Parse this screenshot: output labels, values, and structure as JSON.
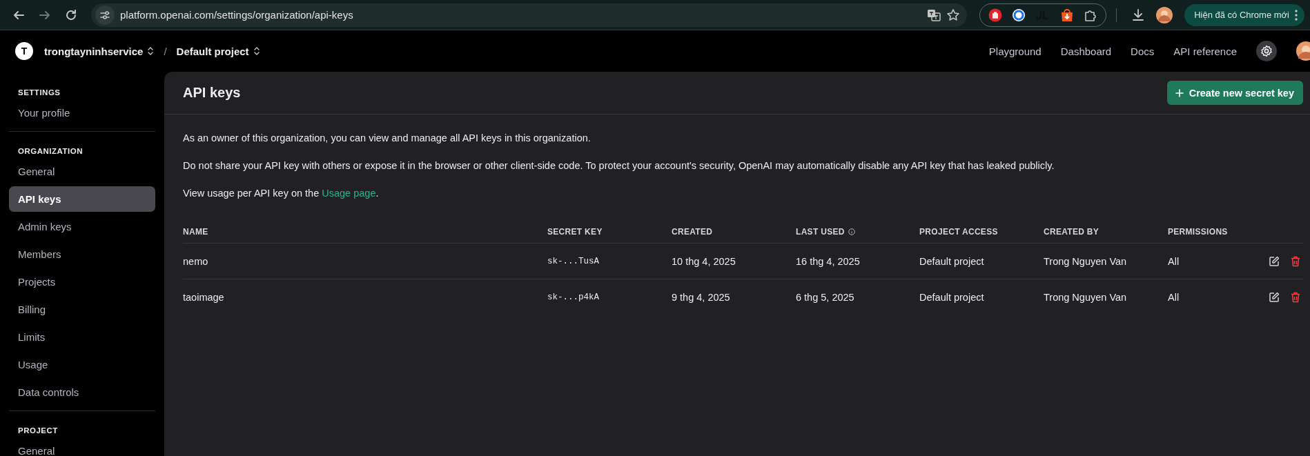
{
  "browser": {
    "url": "platform.openai.com/settings/organization/api-keys",
    "update_button": "Hiện đã có Chrome mới"
  },
  "header": {
    "org_initial": "T",
    "org_name": "trongtayninhservice",
    "separator": "/",
    "project_name": "Default project",
    "nav": [
      "Playground",
      "Dashboard",
      "Docs",
      "API reference"
    ]
  },
  "sidebar": {
    "sections": [
      {
        "heading": "SETTINGS",
        "items": [
          {
            "label": "Your profile",
            "selected": false
          }
        ]
      },
      {
        "heading": "ORGANIZATION",
        "items": [
          {
            "label": "General",
            "selected": false
          },
          {
            "label": "API keys",
            "selected": true
          },
          {
            "label": "Admin keys",
            "selected": false
          },
          {
            "label": "Members",
            "selected": false
          },
          {
            "label": "Projects",
            "selected": false
          },
          {
            "label": "Billing",
            "selected": false
          },
          {
            "label": "Limits",
            "selected": false
          },
          {
            "label": "Usage",
            "selected": false
          },
          {
            "label": "Data controls",
            "selected": false
          }
        ]
      },
      {
        "heading": "PROJECT",
        "items": [
          {
            "label": "General",
            "selected": false
          }
        ]
      }
    ]
  },
  "panel": {
    "title": "API keys",
    "create_button": "Create new secret key",
    "intro": "As an owner of this organization, you can view and manage all API keys in this organization.",
    "warning": "Do not share your API key with others or expose it in the browser or other client-side code. To protect your account's security, OpenAI may automatically disable any API key that has leaked publicly.",
    "usage_note": {
      "before": "View usage per API key on the ",
      "link": "Usage page",
      "after": "."
    },
    "table": {
      "columns": [
        {
          "label": "NAME",
          "info": false
        },
        {
          "label": "SECRET KEY",
          "info": false
        },
        {
          "label": "CREATED",
          "info": false
        },
        {
          "label": "LAST USED",
          "info": true
        },
        {
          "label": "PROJECT ACCESS",
          "info": false
        },
        {
          "label": "CREATED BY",
          "info": false
        },
        {
          "label": "PERMISSIONS",
          "info": false
        }
      ],
      "rows": [
        {
          "name": "nemo",
          "secret_key": "sk-...TusA",
          "created": "10 thg 4, 2025",
          "last_used": "16 thg 4, 2025",
          "project_access": "Default project",
          "created_by": "Trong Nguyen Van",
          "permissions": "All"
        },
        {
          "name": "taoimage",
          "secret_key": "sk-...p4kA",
          "created": "9 thg 4, 2025",
          "last_used": "6 thg 5, 2025",
          "project_access": "Default project",
          "created_by": "Trong Nguyen Van",
          "permissions": "All"
        }
      ]
    }
  }
}
